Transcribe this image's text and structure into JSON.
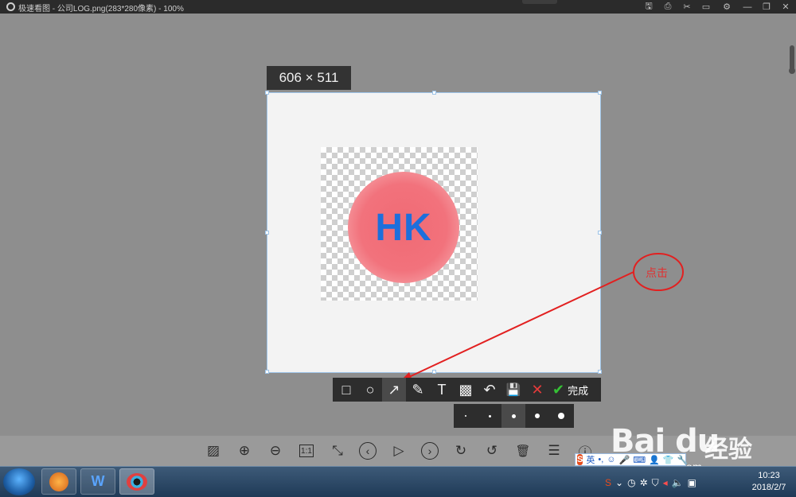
{
  "window": {
    "title": "极速看图 - 公司LOG.png(283*280像素) - 100%"
  },
  "title_controls": [
    "save-icon",
    "print-icon",
    "cut-icon",
    "comment-icon",
    "settings-icon",
    "minimize-icon",
    "restore-icon",
    "close-icon"
  ],
  "selection": {
    "size_label": "606 × 511"
  },
  "logo": {
    "text": "HK",
    "text_color": "#1d6fdc",
    "circle_color": "#f06a74"
  },
  "annotation": {
    "label": "点击",
    "color": "#e23030"
  },
  "capture_toolbar": {
    "tools": [
      {
        "name": "rectangle",
        "glyph": "□"
      },
      {
        "name": "ellipse",
        "glyph": "○"
      },
      {
        "name": "arrow",
        "glyph": "↗"
      },
      {
        "name": "brush",
        "glyph": "✎"
      },
      {
        "name": "text",
        "glyph": "T"
      },
      {
        "name": "mosaic",
        "glyph": "▩"
      },
      {
        "name": "undo",
        "glyph": "↶"
      },
      {
        "name": "save",
        "glyph": "💾"
      },
      {
        "name": "cancel",
        "glyph": "✕"
      }
    ],
    "done_label": "完成"
  },
  "viewer_toolbar": {
    "items": [
      {
        "name": "image",
        "glyph": "▨"
      },
      {
        "name": "zoom-in",
        "glyph": "⊕"
      },
      {
        "name": "zoom-out",
        "glyph": "⊖"
      },
      {
        "name": "actual-size",
        "glyph": "1:1"
      },
      {
        "name": "fit",
        "glyph": "⤡"
      },
      {
        "name": "previous",
        "glyph": "‹"
      },
      {
        "name": "slideshow",
        "glyph": "▷"
      },
      {
        "name": "next",
        "glyph": "›"
      },
      {
        "name": "rotate-right",
        "glyph": "↻"
      },
      {
        "name": "rotate-left",
        "glyph": "↺"
      },
      {
        "name": "delete",
        "glyph": "🗑"
      },
      {
        "name": "menu",
        "glyph": "☰"
      },
      {
        "name": "info",
        "glyph": "ⓘ"
      }
    ]
  },
  "watermark": {
    "brand": "Bai du",
    "suffix": "经验",
    "url": "jingyan.baidu.com"
  },
  "ime": {
    "logo": "S",
    "mode": "英"
  },
  "taskbar": {
    "apps": [
      "browser",
      "W",
      "viewer"
    ],
    "clock_time": "10:23",
    "clock_date": "2018/2/7"
  }
}
